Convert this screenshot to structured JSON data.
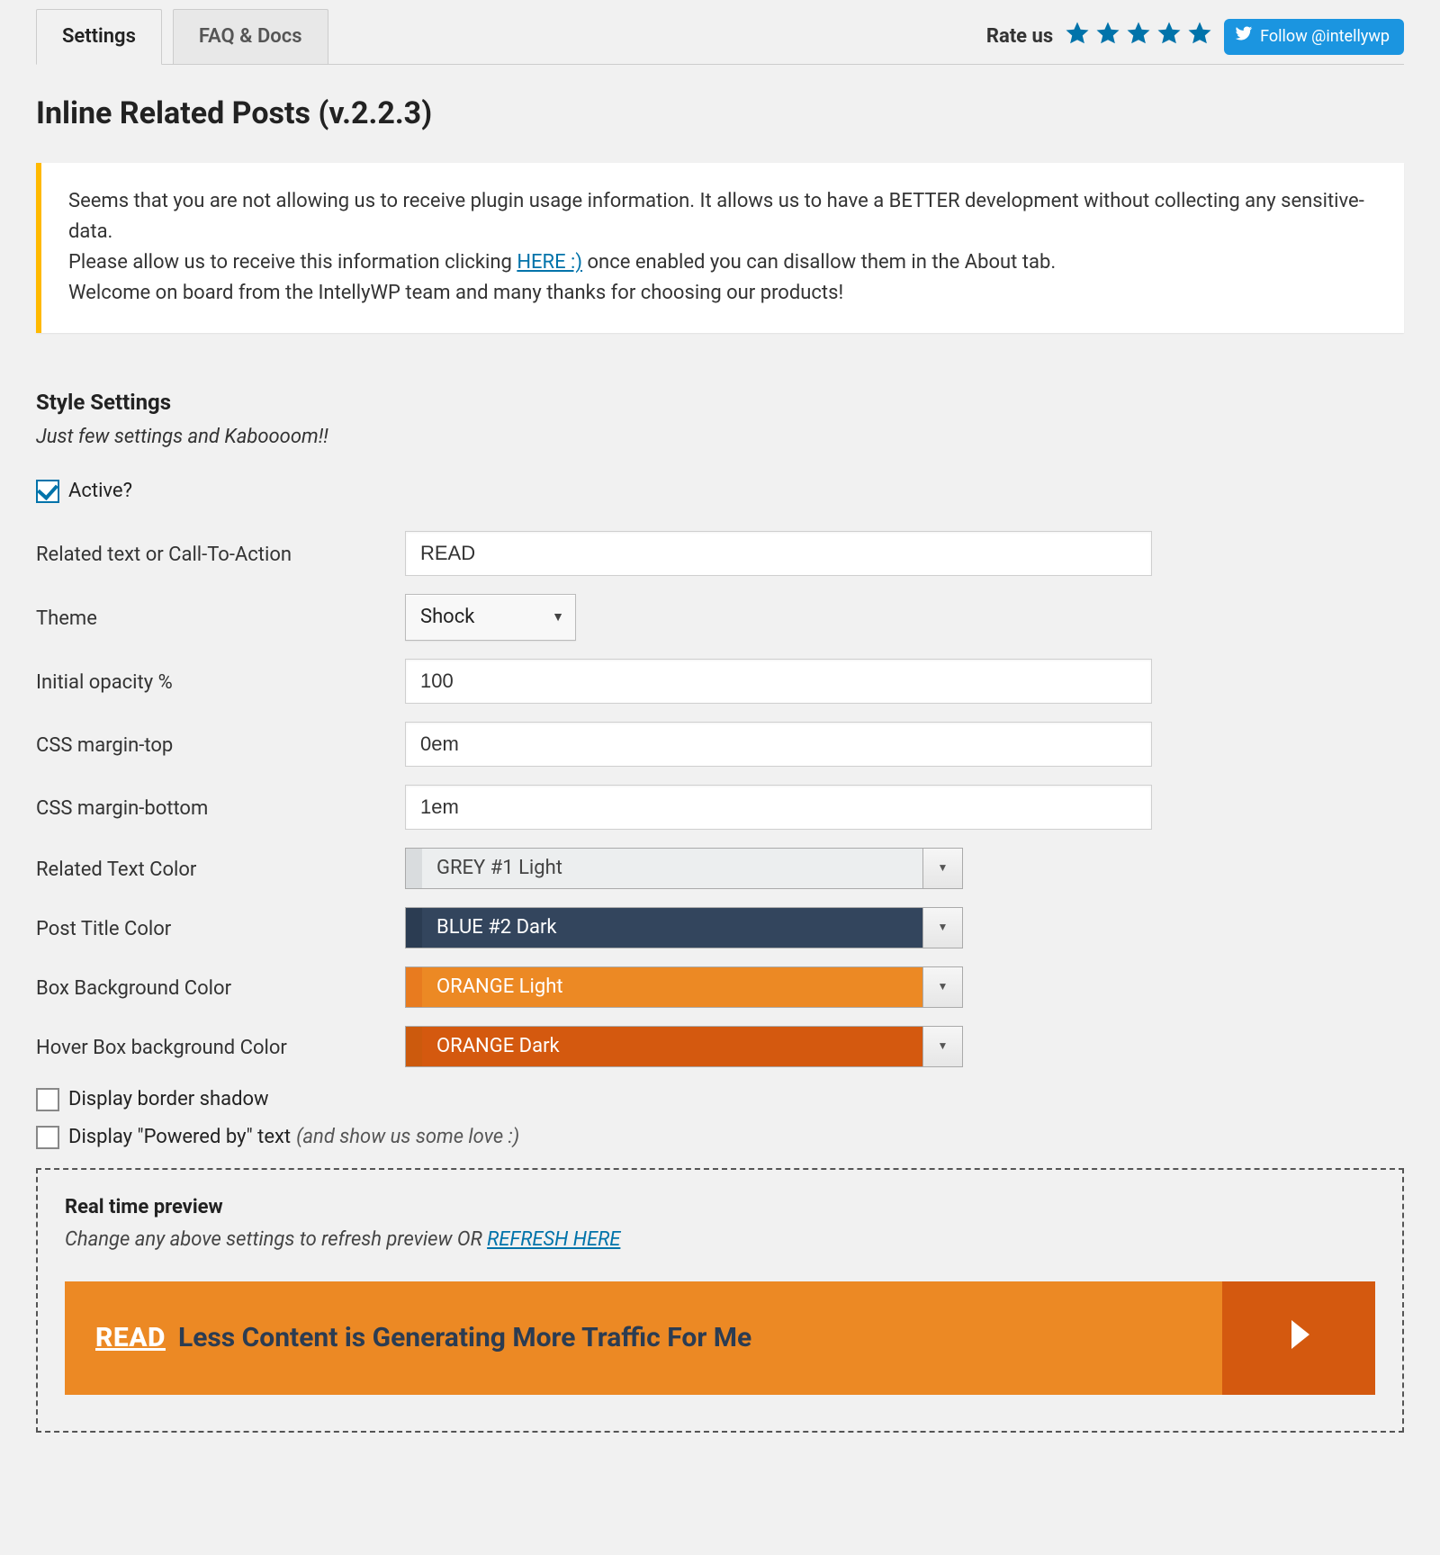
{
  "tabs": {
    "settings": "Settings",
    "faq": "FAQ & Docs"
  },
  "header": {
    "rate_label": "Rate us",
    "follow_label": "Follow @intellywp"
  },
  "page_title": "Inline Related Posts (v.2.2.3)",
  "notice": {
    "line1": "Seems that you are not allowing us to receive plugin usage information. It allows us to have a BETTER development without collecting any sensitive-data.",
    "line2_pre": "Please allow us to receive this information clicking ",
    "line2_link": "HERE :)",
    "line2_post": " once enabled you can disallow them in the About tab.",
    "line3": "Welcome on board from the IntellyWP team and many thanks for choosing our products!"
  },
  "section": {
    "title": "Style Settings",
    "sub": "Just few settings and Kaboooom!!"
  },
  "fields": {
    "active_label": "Active?",
    "related_text_label": "Related text or Call-To-Action",
    "related_text_value": "READ",
    "theme_label": "Theme",
    "theme_value": "Shock",
    "opacity_label": "Initial opacity %",
    "opacity_value": "100",
    "margin_top_label": "CSS margin-top",
    "margin_top_value": "0em",
    "margin_bottom_label": "CSS margin-bottom",
    "margin_bottom_value": "1em",
    "related_color_label": "Related Text Color",
    "related_color_value": "GREY #1 Light",
    "post_title_color_label": "Post Title Color",
    "post_title_color_value": "BLUE #2 Dark",
    "box_bg_label": "Box Background Color",
    "box_bg_value": "ORANGE Light",
    "hover_bg_label": "Hover Box background Color",
    "hover_bg_value": "ORANGE Dark",
    "border_shadow_label": "Display border shadow",
    "powered_label": "Display \"Powered by\" text",
    "powered_hint": "(and show us some love :)"
  },
  "preview": {
    "title": "Real time preview",
    "sub_pre": "Change any above settings to refresh preview OR ",
    "sub_link": "REFRESH HERE",
    "read": "READ",
    "post_title": "Less Content is Generating More Traffic For Me"
  }
}
